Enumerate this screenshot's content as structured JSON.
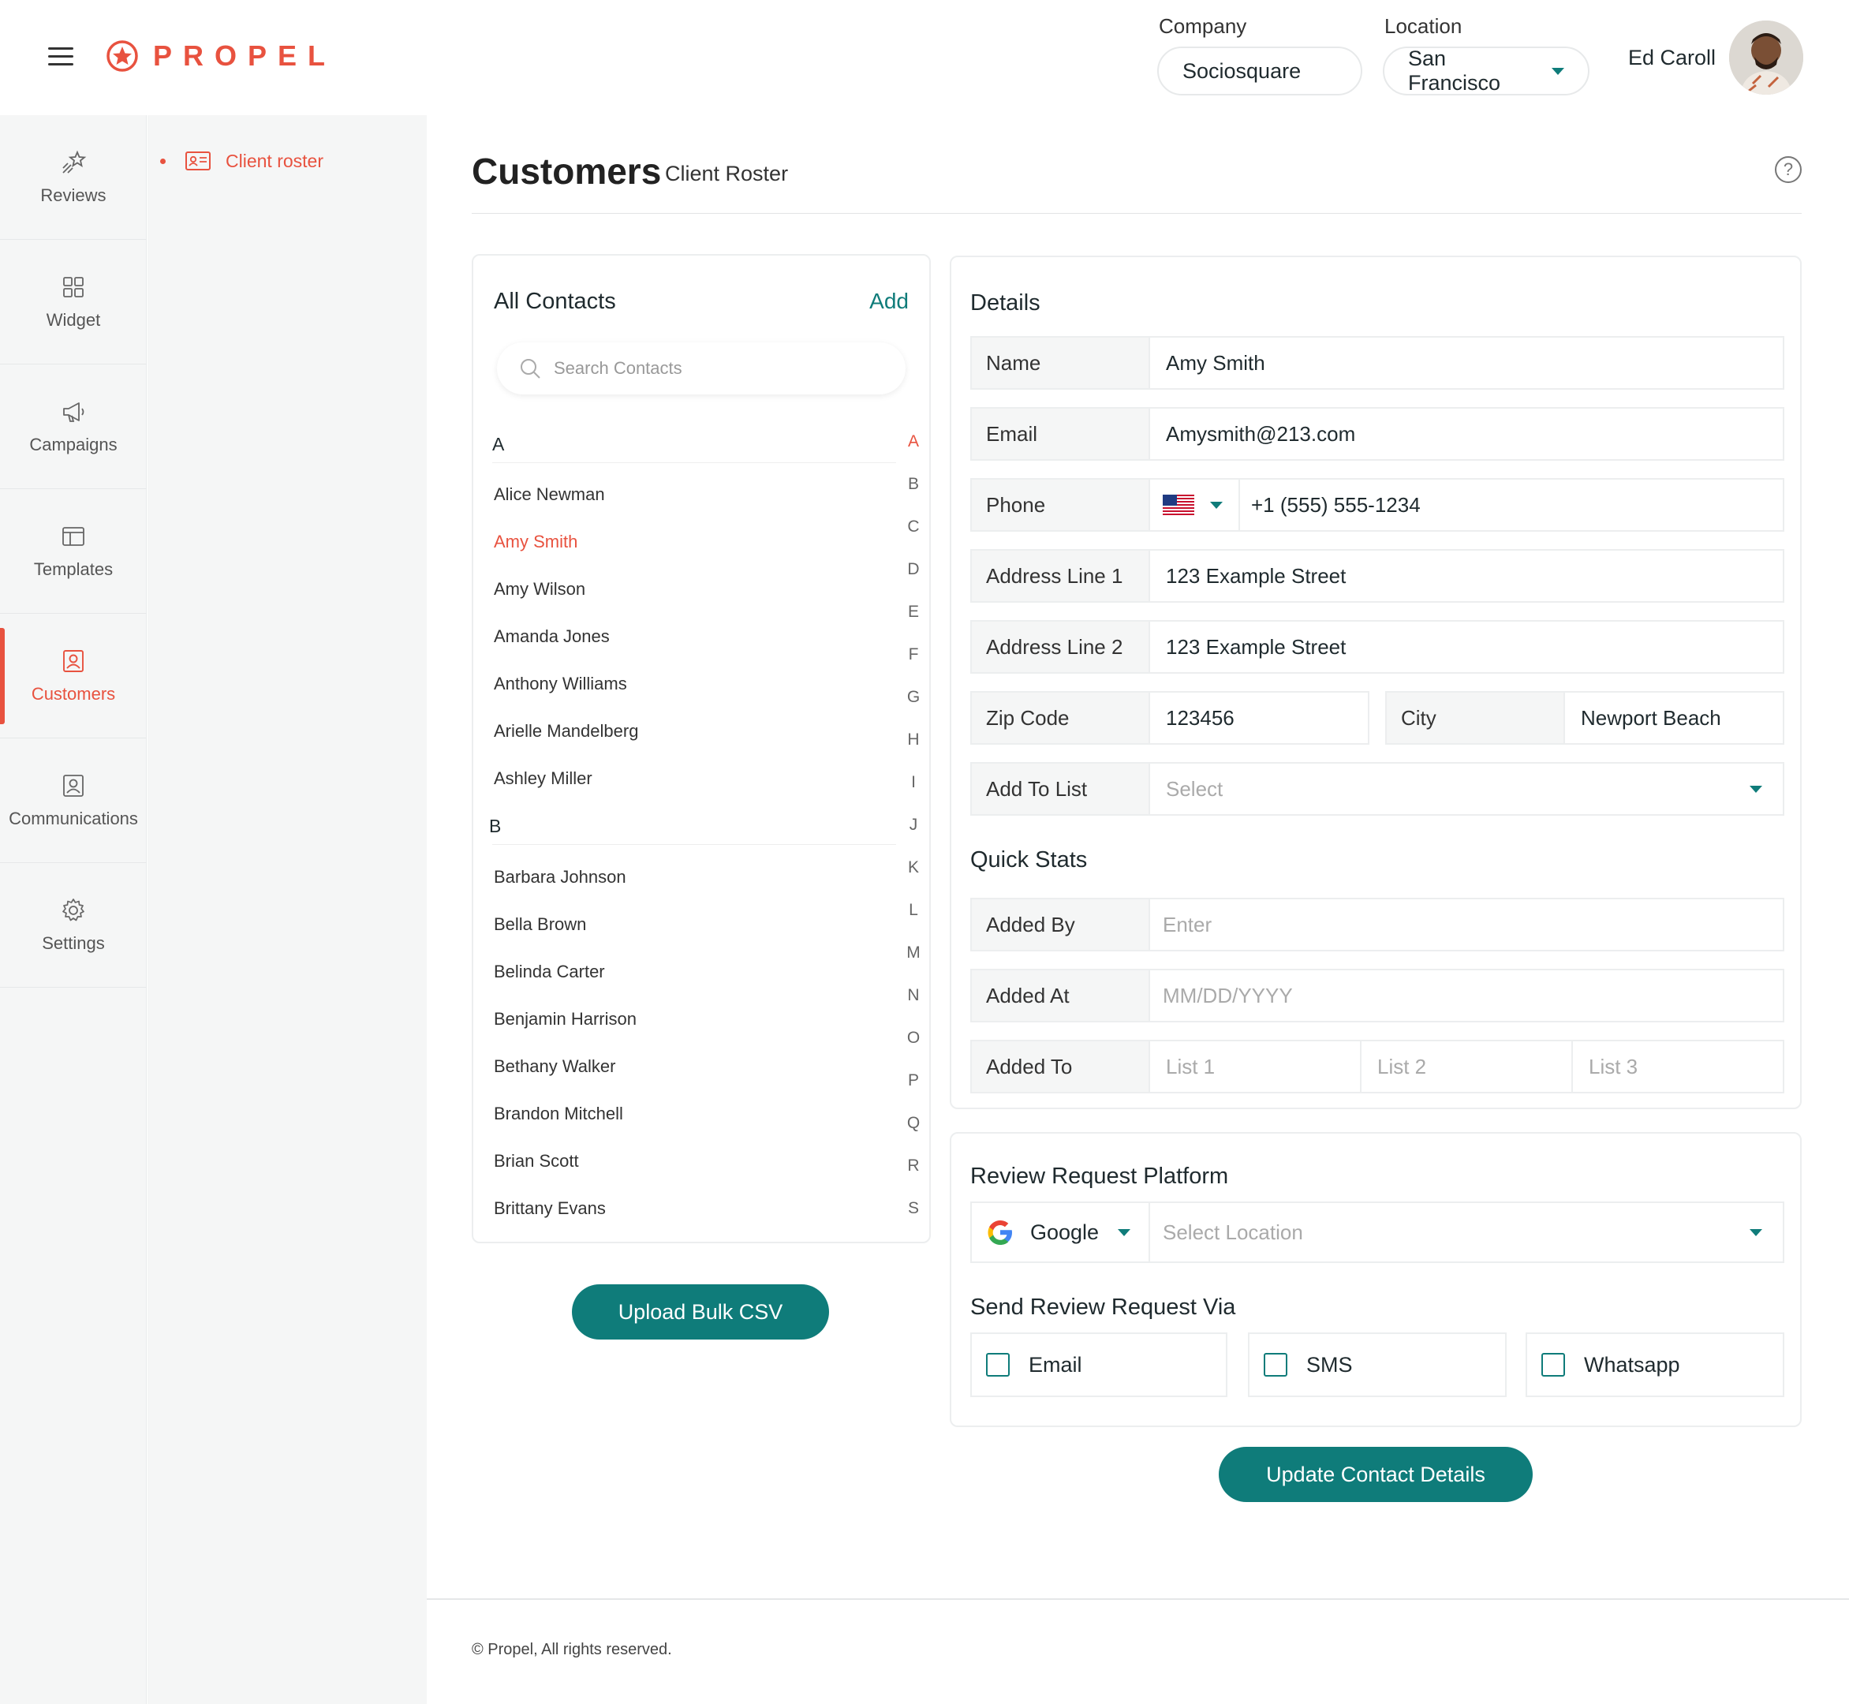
{
  "brand": {
    "name": "PROPEL",
    "accent": "#e8523f",
    "primary": "#0f7c7a"
  },
  "header": {
    "company_label": "Company",
    "company_value": "Sociosquare",
    "location_label": "Location",
    "location_value": "San Francisco",
    "user_name": "Ed Caroll"
  },
  "rail": {
    "items": [
      {
        "label": "Reviews",
        "icon": "star-shooting-icon"
      },
      {
        "label": "Widget",
        "icon": "grid-icon"
      },
      {
        "label": "Campaigns",
        "icon": "megaphone-icon"
      },
      {
        "label": "Templates",
        "icon": "layout-icon"
      },
      {
        "label": "Customers",
        "icon": "user-square-icon",
        "active": true
      },
      {
        "label": "Communications",
        "icon": "user-square-icon"
      },
      {
        "label": "Settings",
        "icon": "gear-icon"
      }
    ]
  },
  "subnav": {
    "item": "Client roster"
  },
  "page": {
    "title": "Customers",
    "subtitle": "Client Roster",
    "help_glyph": "?"
  },
  "contacts": {
    "title": "All Contacts",
    "add_label": "Add",
    "search_placeholder": "Search Contacts",
    "groups": [
      {
        "letter": "A",
        "names": [
          "Alice Newman",
          "Amy Smith",
          "Amy Wilson",
          "Amanda Jones",
          "Anthony Williams",
          "Arielle Mandelberg",
          "Ashley Miller"
        ]
      },
      {
        "letter": "B",
        "names": [
          "Barbara Johnson",
          "Bella Brown",
          "Belinda Carter",
          "Benjamin Harrison",
          "Bethany Walker",
          "Brandon Mitchell",
          "Brian Scott",
          "Brittany Evans"
        ]
      }
    ],
    "selected": "Amy Smith",
    "alphabet": [
      "A",
      "B",
      "C",
      "D",
      "E",
      "F",
      "G",
      "H",
      "I",
      "J",
      "K",
      "L",
      "M",
      "N",
      "O",
      "P",
      "Q",
      "R",
      "S"
    ],
    "upload_label": "Upload Bulk CSV"
  },
  "details": {
    "title": "Details",
    "name_label": "Name",
    "name_value": "Amy Smith",
    "email_label": "Email",
    "email_value": "Amysmith@213.com",
    "phone_label": "Phone",
    "phone_value": "+1 (555) 555-1234",
    "addr1_label": "Address Line 1",
    "addr1_value": "123 Example Street",
    "addr2_label": "Address Line 2",
    "addr2_value": "123 Example Street",
    "zip_label": "Zip Code",
    "zip_value": "123456",
    "city_label": "City",
    "city_value": "Newport Beach",
    "list_label": "Add To List",
    "list_placeholder": "Select"
  },
  "quick_stats": {
    "title": "Quick Stats",
    "added_by_label": "Added By",
    "added_by_placeholder": "Enter",
    "added_at_label": "Added At",
    "added_at_placeholder": "MM/DD/YYYY",
    "added_to_label": "Added To",
    "lists": [
      "List 1",
      "List 2",
      "List 3"
    ]
  },
  "review": {
    "platform_title": "Review Request Platform",
    "platform_value": "Google",
    "location_placeholder": "Select Location",
    "via_title": "Send Review Request Via",
    "channels": [
      "Email",
      "SMS",
      "Whatsapp"
    ]
  },
  "update_label": "Update Contact Details",
  "footer": "© Propel, All rights reserved."
}
